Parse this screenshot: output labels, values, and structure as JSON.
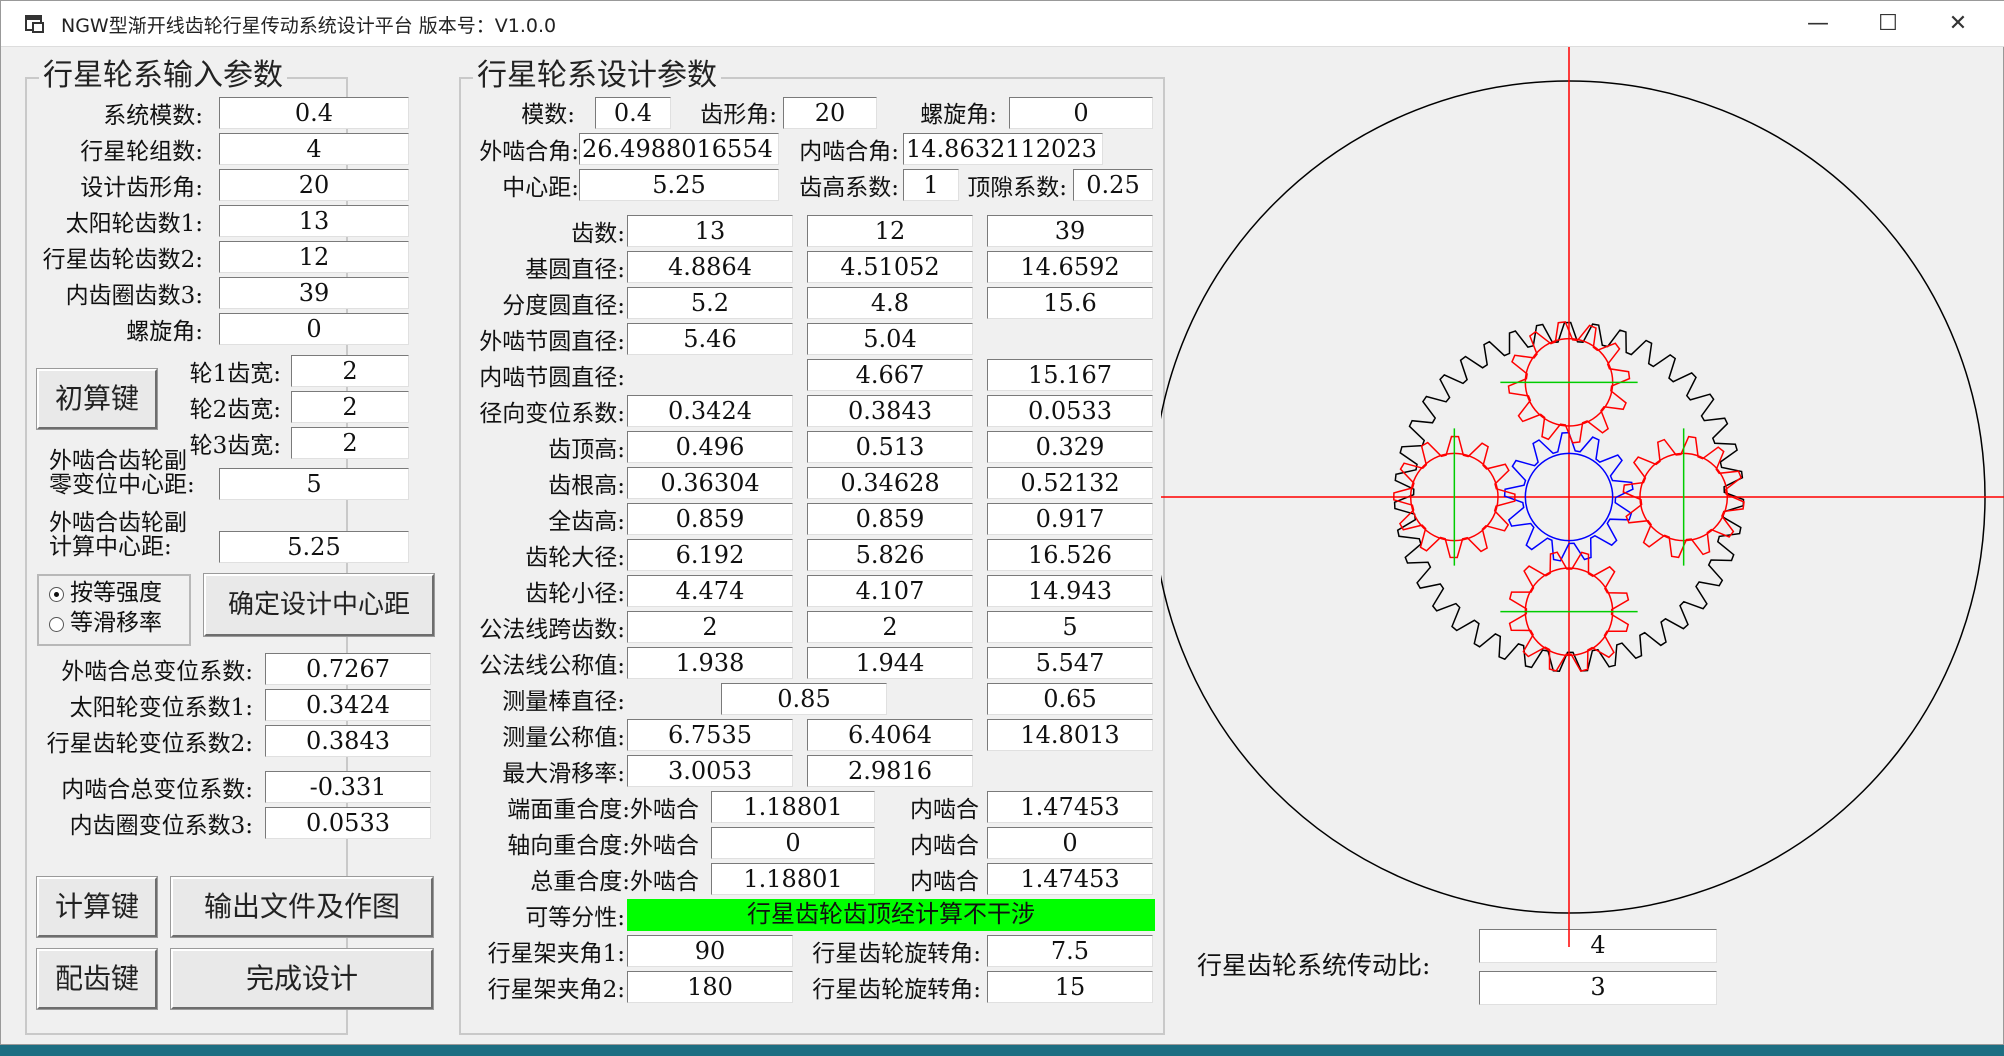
{
  "window": {
    "title": "NGW型渐开线齿轮行星传动系统设计平台 版本号：V1.0.0",
    "min": "—",
    "max": "☐",
    "close": "✕"
  },
  "input": {
    "group": "行星轮系输入参数",
    "rows": [
      {
        "label": "系统模数:",
        "value": "0.4"
      },
      {
        "label": "行星轮组数:",
        "value": "4"
      },
      {
        "label": "设计齿形角:",
        "value": "20"
      },
      {
        "label": "太阳轮齿数1:",
        "value": "13"
      },
      {
        "label": "行星齿轮齿数2:",
        "value": "12"
      },
      {
        "label": "内齿圈齿数3:",
        "value": "39"
      },
      {
        "label": "螺旋角:",
        "value": "0"
      }
    ],
    "calc_btn": "初算键",
    "widths": [
      {
        "label": "轮1齿宽:",
        "value": "2"
      },
      {
        "label": "轮2齿宽:",
        "value": "2"
      },
      {
        "label": "轮3齿宽:",
        "value": "2"
      }
    ],
    "zero_center": {
      "label1": "外啮合齿轮副",
      "label2": "零变位中心距:",
      "value": "5"
    },
    "calc_center": {
      "label1": "外啮合齿轮副",
      "label2": "计算中心距:",
      "value": "5.25"
    },
    "radio1": "按等强度",
    "radio2": "等滑移率",
    "confirm_btn": "确定设计中心距",
    "shift": [
      {
        "label": "外啮合总变位系数:",
        "value": "0.7267"
      },
      {
        "label": "太阳轮变位系数1:",
        "value": "0.3424"
      },
      {
        "label": "行星齿轮变位系数2:",
        "value": "0.3843"
      }
    ],
    "shift2": [
      {
        "label": "内啮合总变位系数:",
        "value": "-0.331"
      },
      {
        "label": "内齿圈变位系数3:",
        "value": "0.0533"
      }
    ],
    "compute_btn": "计算键",
    "output_btn": "输出文件及作图",
    "match_btn": "配齿键",
    "finish_btn": "完成设计"
  },
  "design": {
    "group": "行星轮系设计参数",
    "module_label": "模数:",
    "module": "0.4",
    "angle_label": "齿形角:",
    "angle": "20",
    "helix_label": "螺旋角:",
    "helix": "0",
    "ext_angle_label": "外啮合角:",
    "ext_angle": "26.4988016554",
    "int_angle_label": "内啮合角:",
    "int_angle": "14.8632112023",
    "center_label": "中心距:",
    "center": "5.25",
    "addendum_label": "齿高系数:",
    "addendum": "1",
    "clear_label": "顶隙系数:",
    "clear": "0.25",
    "table": [
      {
        "label": "齿数:",
        "v": [
          "13",
          "12",
          "39"
        ]
      },
      {
        "label": "基圆直径:",
        "v": [
          "4.8864",
          "4.51052",
          "14.6592"
        ]
      },
      {
        "label": "分度圆直径:",
        "v": [
          "5.2",
          "4.8",
          "15.6"
        ]
      },
      {
        "label": "外啮节圆直径:",
        "v": [
          "5.46",
          "5.04",
          ""
        ]
      },
      {
        "label": "内啮节圆直径:",
        "v": [
          "",
          "4.667",
          "15.167"
        ]
      },
      {
        "label": "径向变位系数:",
        "v": [
          "0.3424",
          "0.3843",
          "0.0533"
        ]
      },
      {
        "label": "齿顶高:",
        "v": [
          "0.496",
          "0.513",
          "0.329"
        ]
      },
      {
        "label": "齿根高:",
        "v": [
          "0.36304",
          "0.34628",
          "0.52132"
        ]
      },
      {
        "label": "全齿高:",
        "v": [
          "0.859",
          "0.859",
          "0.917"
        ]
      },
      {
        "label": "齿轮大径:",
        "v": [
          "6.192",
          "5.826",
          "16.526"
        ]
      },
      {
        "label": "齿轮小径:",
        "v": [
          "4.474",
          "4.107",
          "14.943"
        ]
      },
      {
        "label": "公法线跨齿数:",
        "v": [
          "2",
          "2",
          "5"
        ]
      },
      {
        "label": "公法线公称值:",
        "v": [
          "1.938",
          "1.944",
          "5.547"
        ]
      }
    ],
    "rod_label": "测量棒直径:",
    "rod12": "0.85",
    "rod3": "0.65",
    "meas_label": "测量公称值:",
    "meas": [
      "6.7535",
      "6.4064",
      "14.8013"
    ],
    "slide_label": "最大滑移率:",
    "slide": [
      "3.0053",
      "2.9816"
    ],
    "face_label": "端面重合度:外啮合",
    "face_ext": "1.18801",
    "int_label": "内啮合",
    "face_int": "1.47453",
    "axial_label": "轴向重合度:外啮合",
    "axial_ext": "0",
    "axial_int": "0",
    "total_label": "总重合度:外啮合",
    "total_ext": "1.18801",
    "total_int": "1.47453",
    "div_label": "可等分性:",
    "div_value": "行星齿轮齿顶经计算不干涉",
    "carrier1_label": "行星架夹角1:",
    "carrier1": "90",
    "rot1_label": "行星齿轮旋转角:",
    "rot1": "7.5",
    "carrier2_label": "行星架夹角2:",
    "carrier2": "180",
    "rot2_label": "行星齿轮旋转角:",
    "rot2": "15"
  },
  "ratio": {
    "label": "行星齿轮系统传动比:",
    "value1": "4",
    "value2": "3"
  },
  "colors": {
    "sun": "#0000ff",
    "planet": "#ff0000",
    "ring": "#000000",
    "axis": "#ff0000",
    "planet_axis": "#00cc00",
    "green": "#00ff00"
  }
}
